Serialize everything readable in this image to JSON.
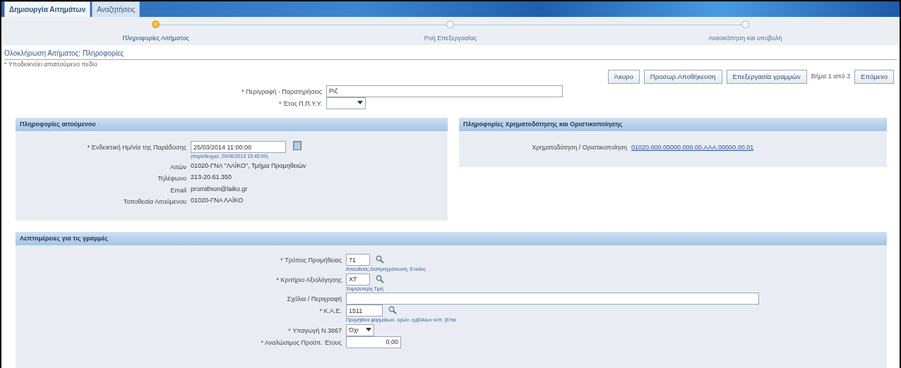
{
  "tabs": [
    {
      "label": "Δημιουργία Αιτημάτων",
      "selected": true
    },
    {
      "label": "Αναζητήσεις",
      "selected": false
    }
  ],
  "train": [
    {
      "label": "Πληροφορίες Αιτήματος",
      "selected": true
    },
    {
      "label": "Ροή Επεξεργασίας",
      "selected": false
    },
    {
      "label": "Ανασκόπηση και υποβολή",
      "selected": false
    }
  ],
  "page_title": "Ολοκλήρωση Αιτήματος: Πληροφορίες",
  "required_note": "* Υποδεικνύει απαιτούμενο πεδίο",
  "actions": [
    {
      "kind": "button",
      "label": "Άκυρο"
    },
    {
      "kind": "button",
      "label": "Προσωρ.Αποθήκευση"
    },
    {
      "kind": "button",
      "label": "Επεξεργασία γραμμών"
    },
    {
      "kind": "text",
      "label": "Βήμα 1 από 3"
    },
    {
      "kind": "button",
      "label": "Επόμενο"
    }
  ],
  "header_fields": [
    {
      "kind": "text",
      "label": "* Περιγραφή - Παρατηρήσεις",
      "value": "Ριζ"
    },
    {
      "kind": "select",
      "label": "* Έτος Π.Π.Υ.Υ."
    }
  ],
  "requester_section": {
    "title": "Πληροφορίες αιτούμενου",
    "fields": [
      {
        "kind": "date",
        "label": "* Ενδεικτική Ημ/νία της Παράδοσης",
        "value": "25/03/2014 11:00:00",
        "hint": "(παράδειγμα: 29/06/2013 15:45:00)"
      },
      {
        "kind": "readonly",
        "label": "Αιτών",
        "value": "01020-ΓΝΑ \"ΛΑΪΚΟ\", Τμήμα Προμηθειών"
      },
      {
        "kind": "readonly",
        "label": "Τηλέφωνο",
        "value": "213-20.61.350"
      },
      {
        "kind": "readonly",
        "label": "Email",
        "value": "promithion@laiko.gr"
      },
      {
        "kind": "readonly",
        "label": "Τοποθεσία Αιτούμενου",
        "value": "01020-ΓΝΑ ΛΑΪΚΟ"
      }
    ]
  },
  "funding_section": {
    "title": "Πληροφορίες Χρηματοδότησης και Οριστικοποίησης",
    "fields": [
      {
        "kind": "link",
        "label": "Χρηματοδότηση / Οριστικοποίηση",
        "value": "01020.000.00000.000.00.ΑΑΑ.00000.00.01"
      }
    ]
  },
  "lines_section": {
    "title": "Λεπτομέρειες για τις γραμμές",
    "fields": [
      {
        "kind": "lov",
        "label": "* Τρόπος Προμήθειας",
        "value": "71",
        "hint": "Απευθείας Διαπραγμάτευση, Ενιαίος"
      },
      {
        "kind": "lov",
        "label": "* Κριτήριο Αξιολόγησης",
        "value": "ΧΤ",
        "hint": "Χαμηλότερη Τιμή"
      },
      {
        "kind": "wide",
        "label": "Σχόλια / Περιγραφή"
      },
      {
        "kind": "lov",
        "label": "* Κ.Α.Ε.",
        "value": "1511",
        "hint": "Προμήθεια φαρμάκων, ορών, εμβολίων κλπ. (Επα"
      },
      {
        "kind": "select",
        "label": "* Υπαγωγή Ν.3867",
        "value": "Όχι"
      },
      {
        "kind": "number",
        "label": "* Αναλώσιμος Προϋπ. Έτους",
        "value": "0,00"
      }
    ]
  }
}
